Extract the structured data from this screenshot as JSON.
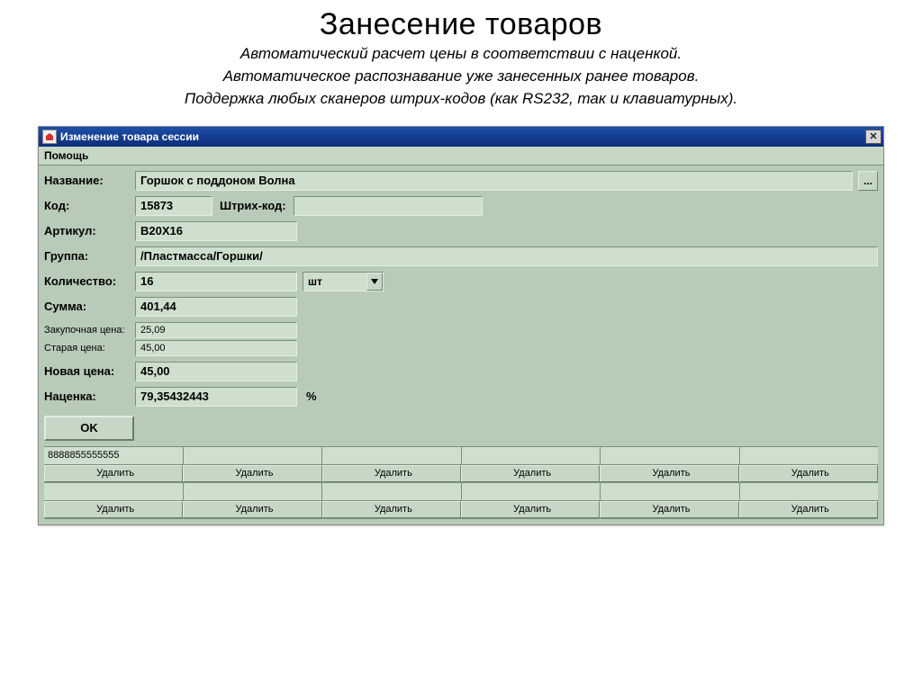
{
  "slide": {
    "title": "Занесение товаров",
    "sub1": "Автоматический расчет цены в соответствии с наценкой.",
    "sub2": "Автоматическое распознавание уже занесенных ранее товаров.",
    "sub3": "Поддержка любых сканеров штрих-кодов (как RS232, так и клавиатурных)."
  },
  "window": {
    "title": "Изменение товара сессии",
    "menu_help": "Помощь"
  },
  "form": {
    "labels": {
      "name": "Название:",
      "code": "Код:",
      "barcode": "Штрих-код:",
      "article": "Артикул:",
      "group": "Группа:",
      "qty": "Количество:",
      "sum": "Сумма:",
      "purchase": "Закупочная цена:",
      "old_price": "Старая цена:",
      "new_price": "Новая цена:",
      "markup": "Наценка:",
      "pct": "%",
      "unit_selected": "шт"
    },
    "values": {
      "name": "Горшок с поддоном Волна",
      "code": "15873",
      "barcode": "",
      "article": "В20Х16",
      "group": "/Пластмасса/Горшки/",
      "qty": "16",
      "sum": "401,44",
      "purchase": "25,09",
      "old_price": "45,00",
      "new_price": "45,00",
      "markup": "79,35432443"
    },
    "more_btn": "...",
    "ok": "OK"
  },
  "grid": {
    "row1": [
      "8888855555555",
      "",
      "",
      "",
      "",
      ""
    ],
    "row2_label": "Удалить",
    "row3": [
      "",
      "",
      "",
      "",
      "",
      ""
    ],
    "row4_label": "Удалить"
  }
}
